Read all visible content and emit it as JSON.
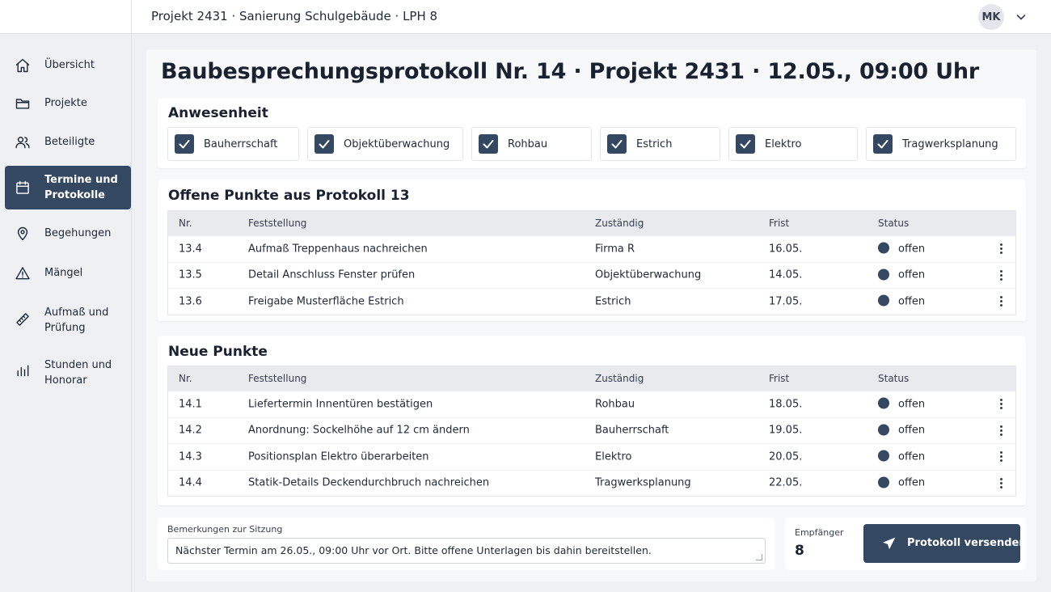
{
  "header": {
    "project": "Projekt 2431 · Sanierung Schulgebäude · LPH 8",
    "avatar": "MK"
  },
  "sidebar": {
    "items": [
      {
        "label": "Übersicht",
        "icon": "home-icon"
      },
      {
        "label": "Projekte",
        "icon": "folder-icon"
      },
      {
        "label": "Beteiligte",
        "icon": "users-icon"
      },
      {
        "label": "Termine und Protokolle",
        "icon": "calendar-icon",
        "active": true
      },
      {
        "label": "Begehungen",
        "icon": "location-pin-icon"
      },
      {
        "label": "Mängel",
        "icon": "warning-icon"
      },
      {
        "label": "Aufmaß und Prüfung",
        "icon": "ruler-icon"
      },
      {
        "label": "Stunden und Honorar",
        "icon": "bar-chart-icon"
      }
    ]
  },
  "page": {
    "title": "Baubesprechungsprotokoll Nr. 14 · Projekt 2431 · 12.05., 09:00 Uhr"
  },
  "attendance": {
    "heading": "Anwesenheit",
    "items": [
      {
        "label": "Bauherrschaft",
        "checked": true
      },
      {
        "label": "Objektüberwachung",
        "checked": true
      },
      {
        "label": "Rohbau",
        "checked": true
      },
      {
        "label": "Estrich",
        "checked": true
      },
      {
        "label": "Elektro",
        "checked": true
      },
      {
        "label": "Tragwerksplanung",
        "checked": true
      }
    ]
  },
  "columns": {
    "nr": "Nr.",
    "finding": "Feststellung",
    "responsible": "Zuständig",
    "deadline": "Frist",
    "status": "Status"
  },
  "open_points": {
    "heading": "Offene Punkte aus Protokoll 13",
    "rows": [
      {
        "nr": "13.4",
        "finding": "Aufmaß Treppenhaus nachreichen",
        "responsible": "Firma R",
        "deadline": "16.05.",
        "status": "offen"
      },
      {
        "nr": "13.5",
        "finding": "Detail Anschluss Fenster prüfen",
        "responsible": "Objektüberwachung",
        "deadline": "14.05.",
        "status": "offen"
      },
      {
        "nr": "13.6",
        "finding": "Freigabe Musterfläche Estrich",
        "responsible": "Estrich",
        "deadline": "17.05.",
        "status": "offen"
      }
    ]
  },
  "new_points": {
    "heading": "Neue Punkte",
    "rows": [
      {
        "nr": "14.1",
        "finding": "Liefertermin Innentüren bestätigen",
        "responsible": "Rohbau",
        "deadline": "18.05.",
        "status": "offen"
      },
      {
        "nr": "14.2",
        "finding": "Anordnung: Sockelhöhe auf 12 cm ändern",
        "responsible": "Bauherrschaft",
        "deadline": "19.05.",
        "status": "offen"
      },
      {
        "nr": "14.3",
        "finding": "Positionsplan Elektro überarbeiten",
        "responsible": "Elektro",
        "deadline": "20.05.",
        "status": "offen"
      },
      {
        "nr": "14.4",
        "finding": "Statik-Details Deckendurchbruch nachreichen",
        "responsible": "Tragwerksplanung",
        "deadline": "22.05.",
        "status": "offen"
      }
    ]
  },
  "remarks": {
    "label": "Bemerkungen zur Sitzung",
    "value": "Nächster Termin am 26.05., 09:00 Uhr vor Ort. Bitte offene Unterlagen bis dahin bereitstellen."
  },
  "recipients": {
    "label": "Empfänger",
    "count": "8"
  },
  "send_button": "Protokoll versenden",
  "colors": {
    "accent": "#344861",
    "background": "#eef0f3",
    "status_open": "#344861"
  }
}
